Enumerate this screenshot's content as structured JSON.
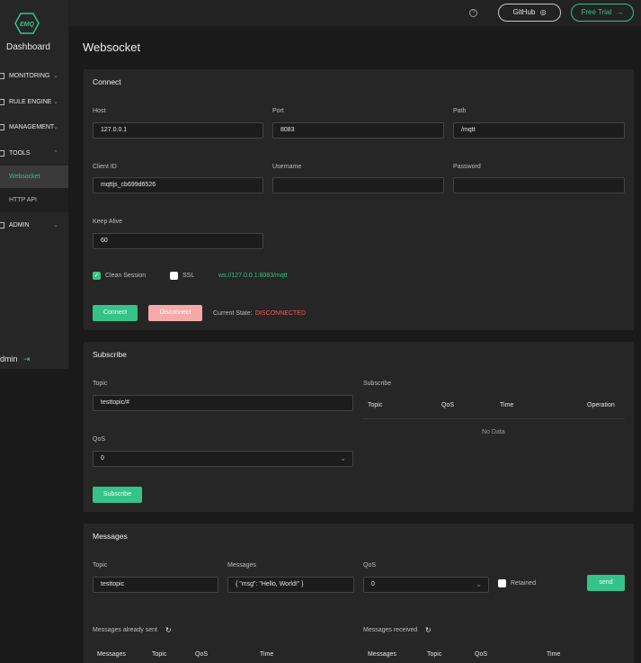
{
  "topbar": {
    "help_icon": "?",
    "github_label": "GitHub",
    "github_icon": "github-icon",
    "trial_label": "Free Trial",
    "trial_arrow": "→"
  },
  "sidebar": {
    "logo_text": "EMQ",
    "brand": "Dashboard",
    "items": [
      {
        "label": "MONITORING",
        "chevron": "⌄"
      },
      {
        "label": "RULE ENGINE",
        "chevron": "⌄"
      },
      {
        "label": "MANAGEMENT",
        "chevron": "⌄"
      },
      {
        "label": "TOOLS",
        "chevron": "⌃"
      },
      {
        "label": "ADMIN",
        "chevron": "⌄"
      }
    ],
    "sub_items": [
      {
        "label": "Websocket"
      },
      {
        "label": "HTTP API"
      }
    ],
    "user": "dmin",
    "logout_icon": "⇥"
  },
  "page_title": "Websocket",
  "connect": {
    "title": "Connect",
    "host_label": "Host",
    "host_value": "127.0.0.1",
    "port_label": "Port",
    "port_value": "8083",
    "path_label": "Path",
    "path_value": "/mqtt",
    "client_id_label": "Client ID",
    "client_id_value": "mqttjs_cb699d6526",
    "username_label": "Username",
    "username_value": "",
    "password_label": "Password",
    "password_value": "",
    "keepalive_label": "Keep Alive",
    "keepalive_value": "60",
    "clean_session_label": "Clean Session",
    "clean_session_checked": true,
    "ssl_label": "SSL",
    "ssl_checked": false,
    "ws_url": "ws://127.0.0.1:8083/mqtt",
    "connect_button": "Connect",
    "disconnect_button": "Disconnect",
    "state_label": "Current State:",
    "state_value": "DISCONNECTED"
  },
  "subscribe": {
    "title": "Subscribe",
    "topic_label": "Topic",
    "topic_value": "testtopic/#",
    "qos_label": "QoS",
    "qos_value": "0",
    "button": "Subscribe",
    "table_title": "Subscribe",
    "columns": [
      "Topic",
      "QoS",
      "Time",
      "Operation"
    ],
    "empty_text": "No Data"
  },
  "messages": {
    "title": "Messages",
    "topic_label": "Topic",
    "topic_value": "testtopic",
    "messages_label": "Messages",
    "messages_value": "{ \"msg\": \"Hello, World!\" }",
    "qos_label": "QoS",
    "qos_value": "0",
    "retained_label": "Retained",
    "send_button": "send",
    "sent_title": "Messages already sent",
    "received_title": "Messages received",
    "sent_columns": [
      "Messages",
      "Topic",
      "QoS",
      "Time"
    ],
    "received_columns": [
      "Messages",
      "Topic",
      "QoS",
      "Time"
    ]
  },
  "colors": {
    "accent": "#34c388",
    "error": "#f05a5a",
    "background": "#1a1a1a",
    "panel": "#262626"
  }
}
